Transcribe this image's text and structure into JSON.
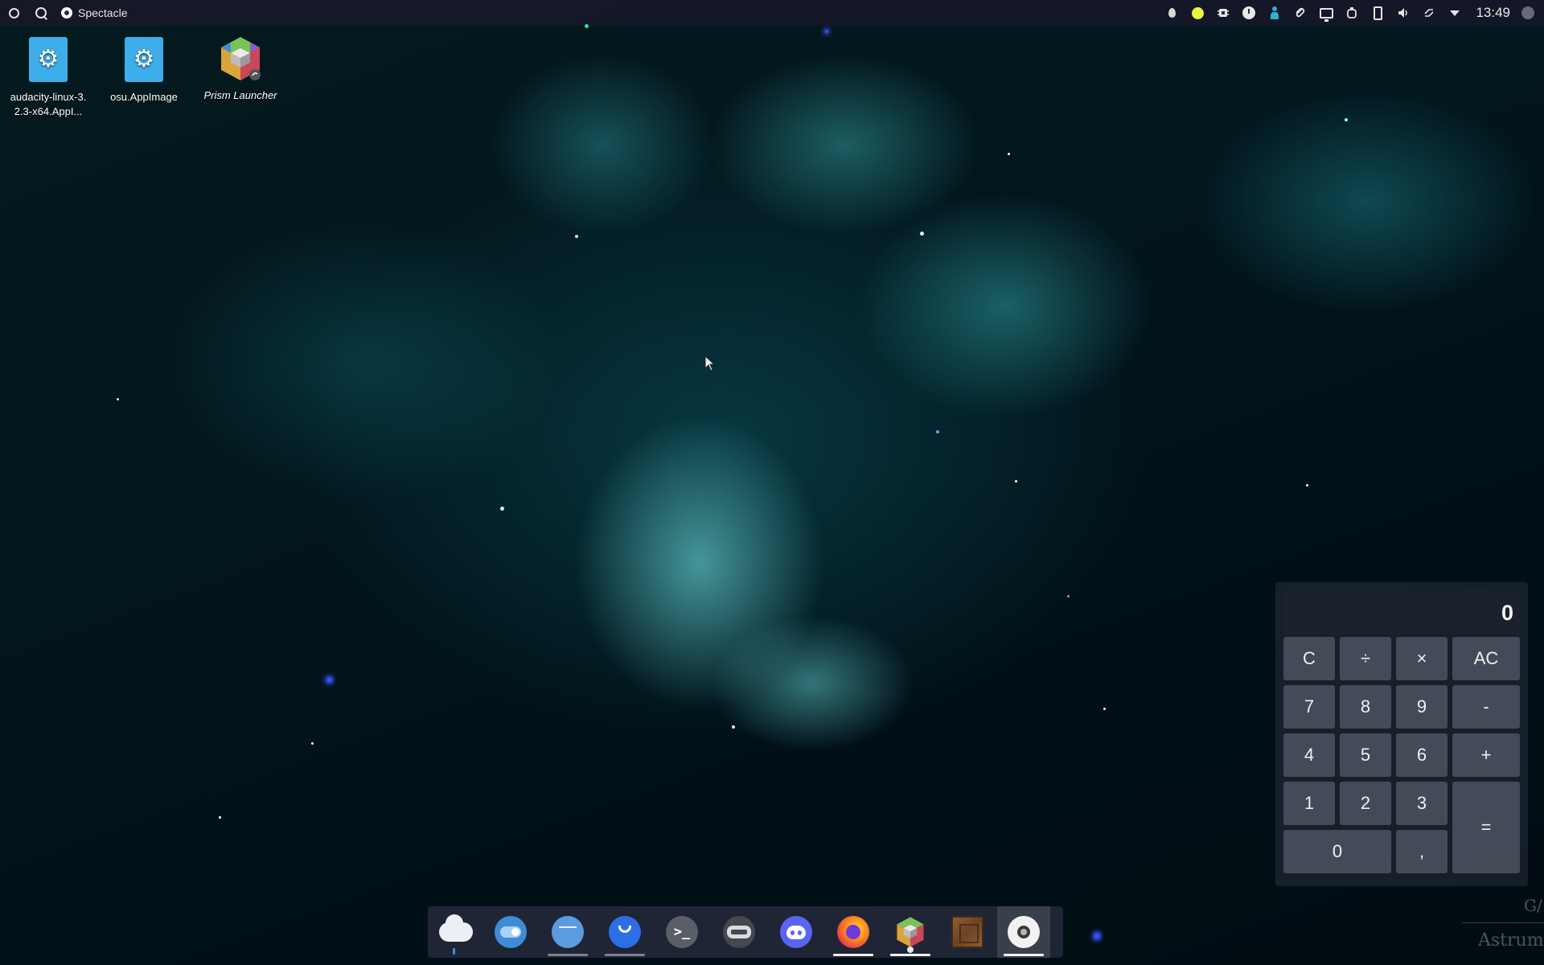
{
  "top_panel": {
    "active_task": "Spectacle",
    "clock": "13:49",
    "tray_icons": [
      "water-drop-icon",
      "yellow-status-icon",
      "chip-icon",
      "clock-icon",
      "person-icon",
      "paperclip-icon",
      "monitor-icon",
      "cup-icon",
      "battery-icon",
      "volume-icon",
      "sync-icon",
      "tray-expand-icon",
      "user-avatar-icon"
    ]
  },
  "desktop": {
    "icons": [
      {
        "label": "audacity-linux-3.\n2.3-x64.AppI...",
        "icon": "gear-icon"
      },
      {
        "label": "osu.AppImage",
        "icon": "gear-icon"
      },
      {
        "label": "Prism Launcher",
        "icon": "prism-launcher-icon"
      }
    ]
  },
  "calculator": {
    "display": "0",
    "keys": {
      "clear": "C",
      "divide": "÷",
      "multiply": "×",
      "all_clear": "AC",
      "seven": "7",
      "eight": "8",
      "nine": "9",
      "minus": "-",
      "four": "4",
      "five": "5",
      "six": "6",
      "plus": "+",
      "one": "1",
      "two": "2",
      "three": "3",
      "equals": "=",
      "zero": "0",
      "decimal": ","
    }
  },
  "dock": {
    "items": [
      "weather-cloud-icon",
      "toggle-settings-icon",
      "file-manager-icon",
      "mail-client-icon",
      "terminal-icon",
      "game-launcher-icon",
      "discord-icon",
      "firefox-icon",
      "prism-launcher-icon",
      "minecraft-icon",
      "obs-icon"
    ]
  },
  "watermark": {
    "text_top": "G/",
    "text_bottom": "Astrum"
  },
  "colors": {
    "accent": "#3daee9",
    "panel": "#16182a",
    "calc_display_text": "#f2f2f2"
  }
}
